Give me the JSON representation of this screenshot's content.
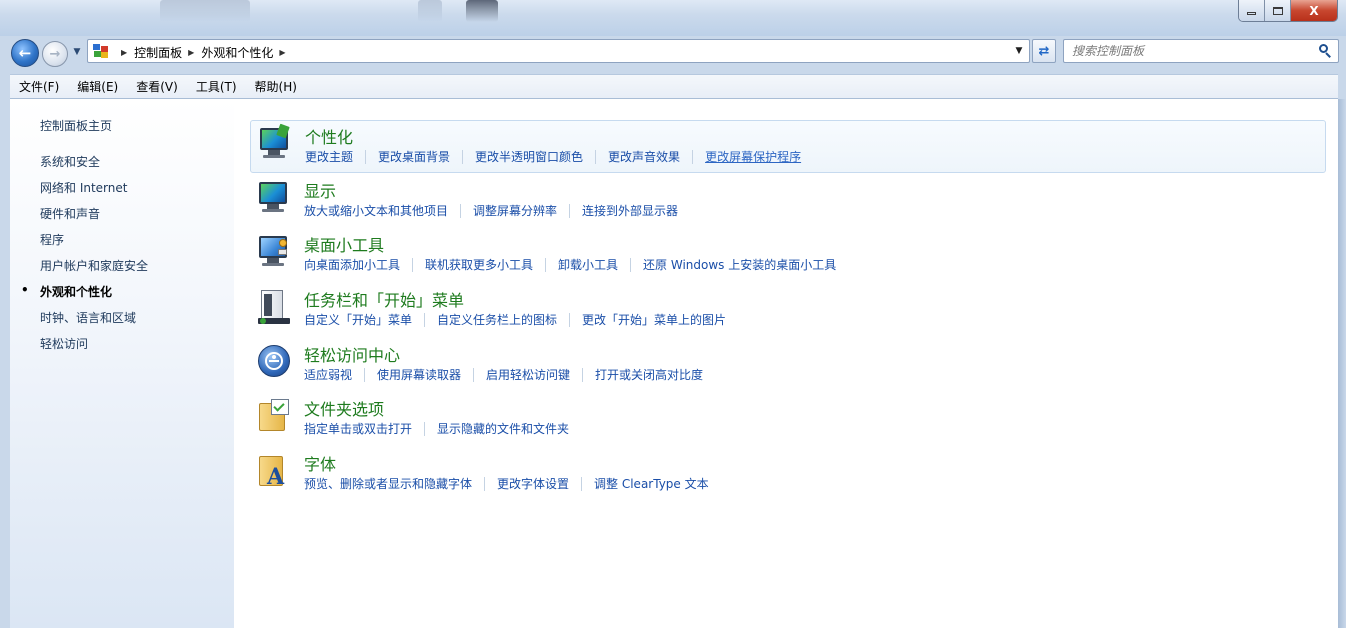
{
  "window": {
    "caption": {
      "minimize": "—",
      "maximize": "□",
      "close": "X"
    }
  },
  "nav": {
    "back_icon": "back-arrow-icon",
    "forward_icon": "forward-arrow-icon",
    "breadcrumb": [
      "控制面板",
      "外观和个性化"
    ],
    "search_placeholder": "搜索控制面板"
  },
  "menu": [
    "文件(F)",
    "编辑(E)",
    "查看(V)",
    "工具(T)",
    "帮助(H)"
  ],
  "sidebar": {
    "home": "控制面板主页",
    "items": [
      {
        "label": "系统和安全",
        "current": false
      },
      {
        "label": "网络和 Internet",
        "current": false
      },
      {
        "label": "硬件和声音",
        "current": false
      },
      {
        "label": "程序",
        "current": false
      },
      {
        "label": "用户帐户和家庭安全",
        "current": false
      },
      {
        "label": "外观和个性化",
        "current": true
      },
      {
        "label": "时钟、语言和区域",
        "current": false
      },
      {
        "label": "轻松访问",
        "current": false
      }
    ],
    "bullet": "•"
  },
  "categories": [
    {
      "title": "个性化",
      "icon": "personalization-icon",
      "links": [
        "更改主题",
        "更改桌面背景",
        "更改半透明窗口颜色",
        "更改声音效果",
        "更改屏幕保护程序"
      ]
    },
    {
      "title": "显示",
      "icon": "display-icon",
      "links": [
        "放大或缩小文本和其他项目",
        "调整屏幕分辨率",
        "连接到外部显示器"
      ]
    },
    {
      "title": "桌面小工具",
      "icon": "desktop-gadgets-icon",
      "links": [
        "向桌面添加小工具",
        "联机获取更多小工具",
        "卸载小工具",
        "还原 Windows 上安装的桌面小工具"
      ]
    },
    {
      "title": "任务栏和「开始」菜单",
      "icon": "taskbar-start-menu-icon",
      "links": [
        "自定义「开始」菜单",
        "自定义任务栏上的图标",
        "更改「开始」菜单上的图片"
      ]
    },
    {
      "title": "轻松访问中心",
      "icon": "ease-of-access-icon",
      "links": [
        "适应弱视",
        "使用屏幕读取器",
        "启用轻松访问键",
        "打开或关闭高对比度"
      ]
    },
    {
      "title": "文件夹选项",
      "icon": "folder-options-icon",
      "links": [
        "指定单击或双击打开",
        "显示隐藏的文件和文件夹"
      ]
    },
    {
      "title": "字体",
      "icon": "fonts-icon",
      "links": [
        "预览、删除或者显示和隐藏字体",
        "更改字体设置",
        "调整 ClearType 文本"
      ]
    }
  ],
  "colors": {
    "category_title": "#1e7b1e",
    "link": "#1a4ea8",
    "sidebar_text": "#1e395b",
    "close_button": "#c8472f"
  }
}
